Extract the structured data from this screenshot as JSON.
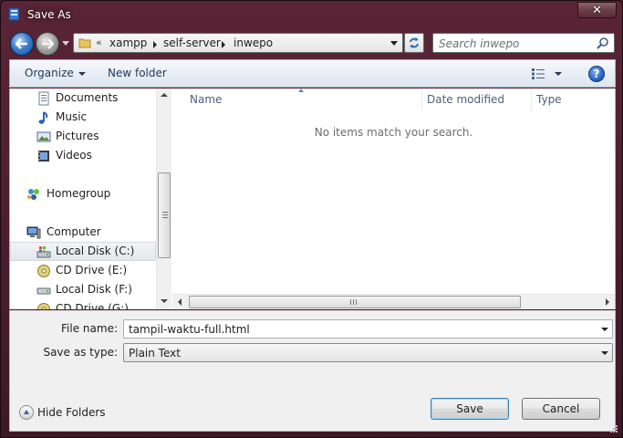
{
  "window": {
    "title": "Save As",
    "close_label": "✕"
  },
  "address_bar": {
    "overflow_marker": "«",
    "crumbs": [
      "xampp",
      "self-server",
      "inwepo"
    ]
  },
  "search": {
    "placeholder": "Search inwepo"
  },
  "toolbar": {
    "organize_label": "Organize",
    "new_folder_label": "New folder",
    "help_label": "?"
  },
  "nav_pane": {
    "items": [
      {
        "label": "Documents",
        "icon": "documents-icon"
      },
      {
        "label": "Music",
        "icon": "music-icon"
      },
      {
        "label": "Pictures",
        "icon": "pictures-icon"
      },
      {
        "label": "Videos",
        "icon": "videos-icon"
      },
      {
        "label": "Homegroup",
        "icon": "homegroup-icon"
      },
      {
        "label": "Computer",
        "icon": "computer-icon"
      },
      {
        "label": "Local Disk (C:)",
        "icon": "local-disk-icon",
        "selected": true
      },
      {
        "label": "CD Drive (E:)",
        "icon": "cd-drive-icon"
      },
      {
        "label": "Local Disk (F:)",
        "icon": "removable-disk-icon"
      },
      {
        "label": "CD Drive (G:)",
        "icon": "cd-drive-icon"
      }
    ]
  },
  "file_list": {
    "columns": [
      "Name",
      "Date modified",
      "Type"
    ],
    "empty_message": "No items match your search."
  },
  "form": {
    "file_name_label": "File name:",
    "file_name_value": "tampil-waktu-full.html",
    "save_as_type_label": "Save as type:",
    "save_as_type_value": "Plain Text"
  },
  "footer": {
    "hide_folders_label": "Hide Folders",
    "save_label": "Save",
    "cancel_label": "Cancel"
  },
  "colors": {
    "frame": "#4a1d2d",
    "toolbar_text": "#1e395b",
    "header_text": "#4c607a",
    "selection": "#e3e7ec"
  }
}
